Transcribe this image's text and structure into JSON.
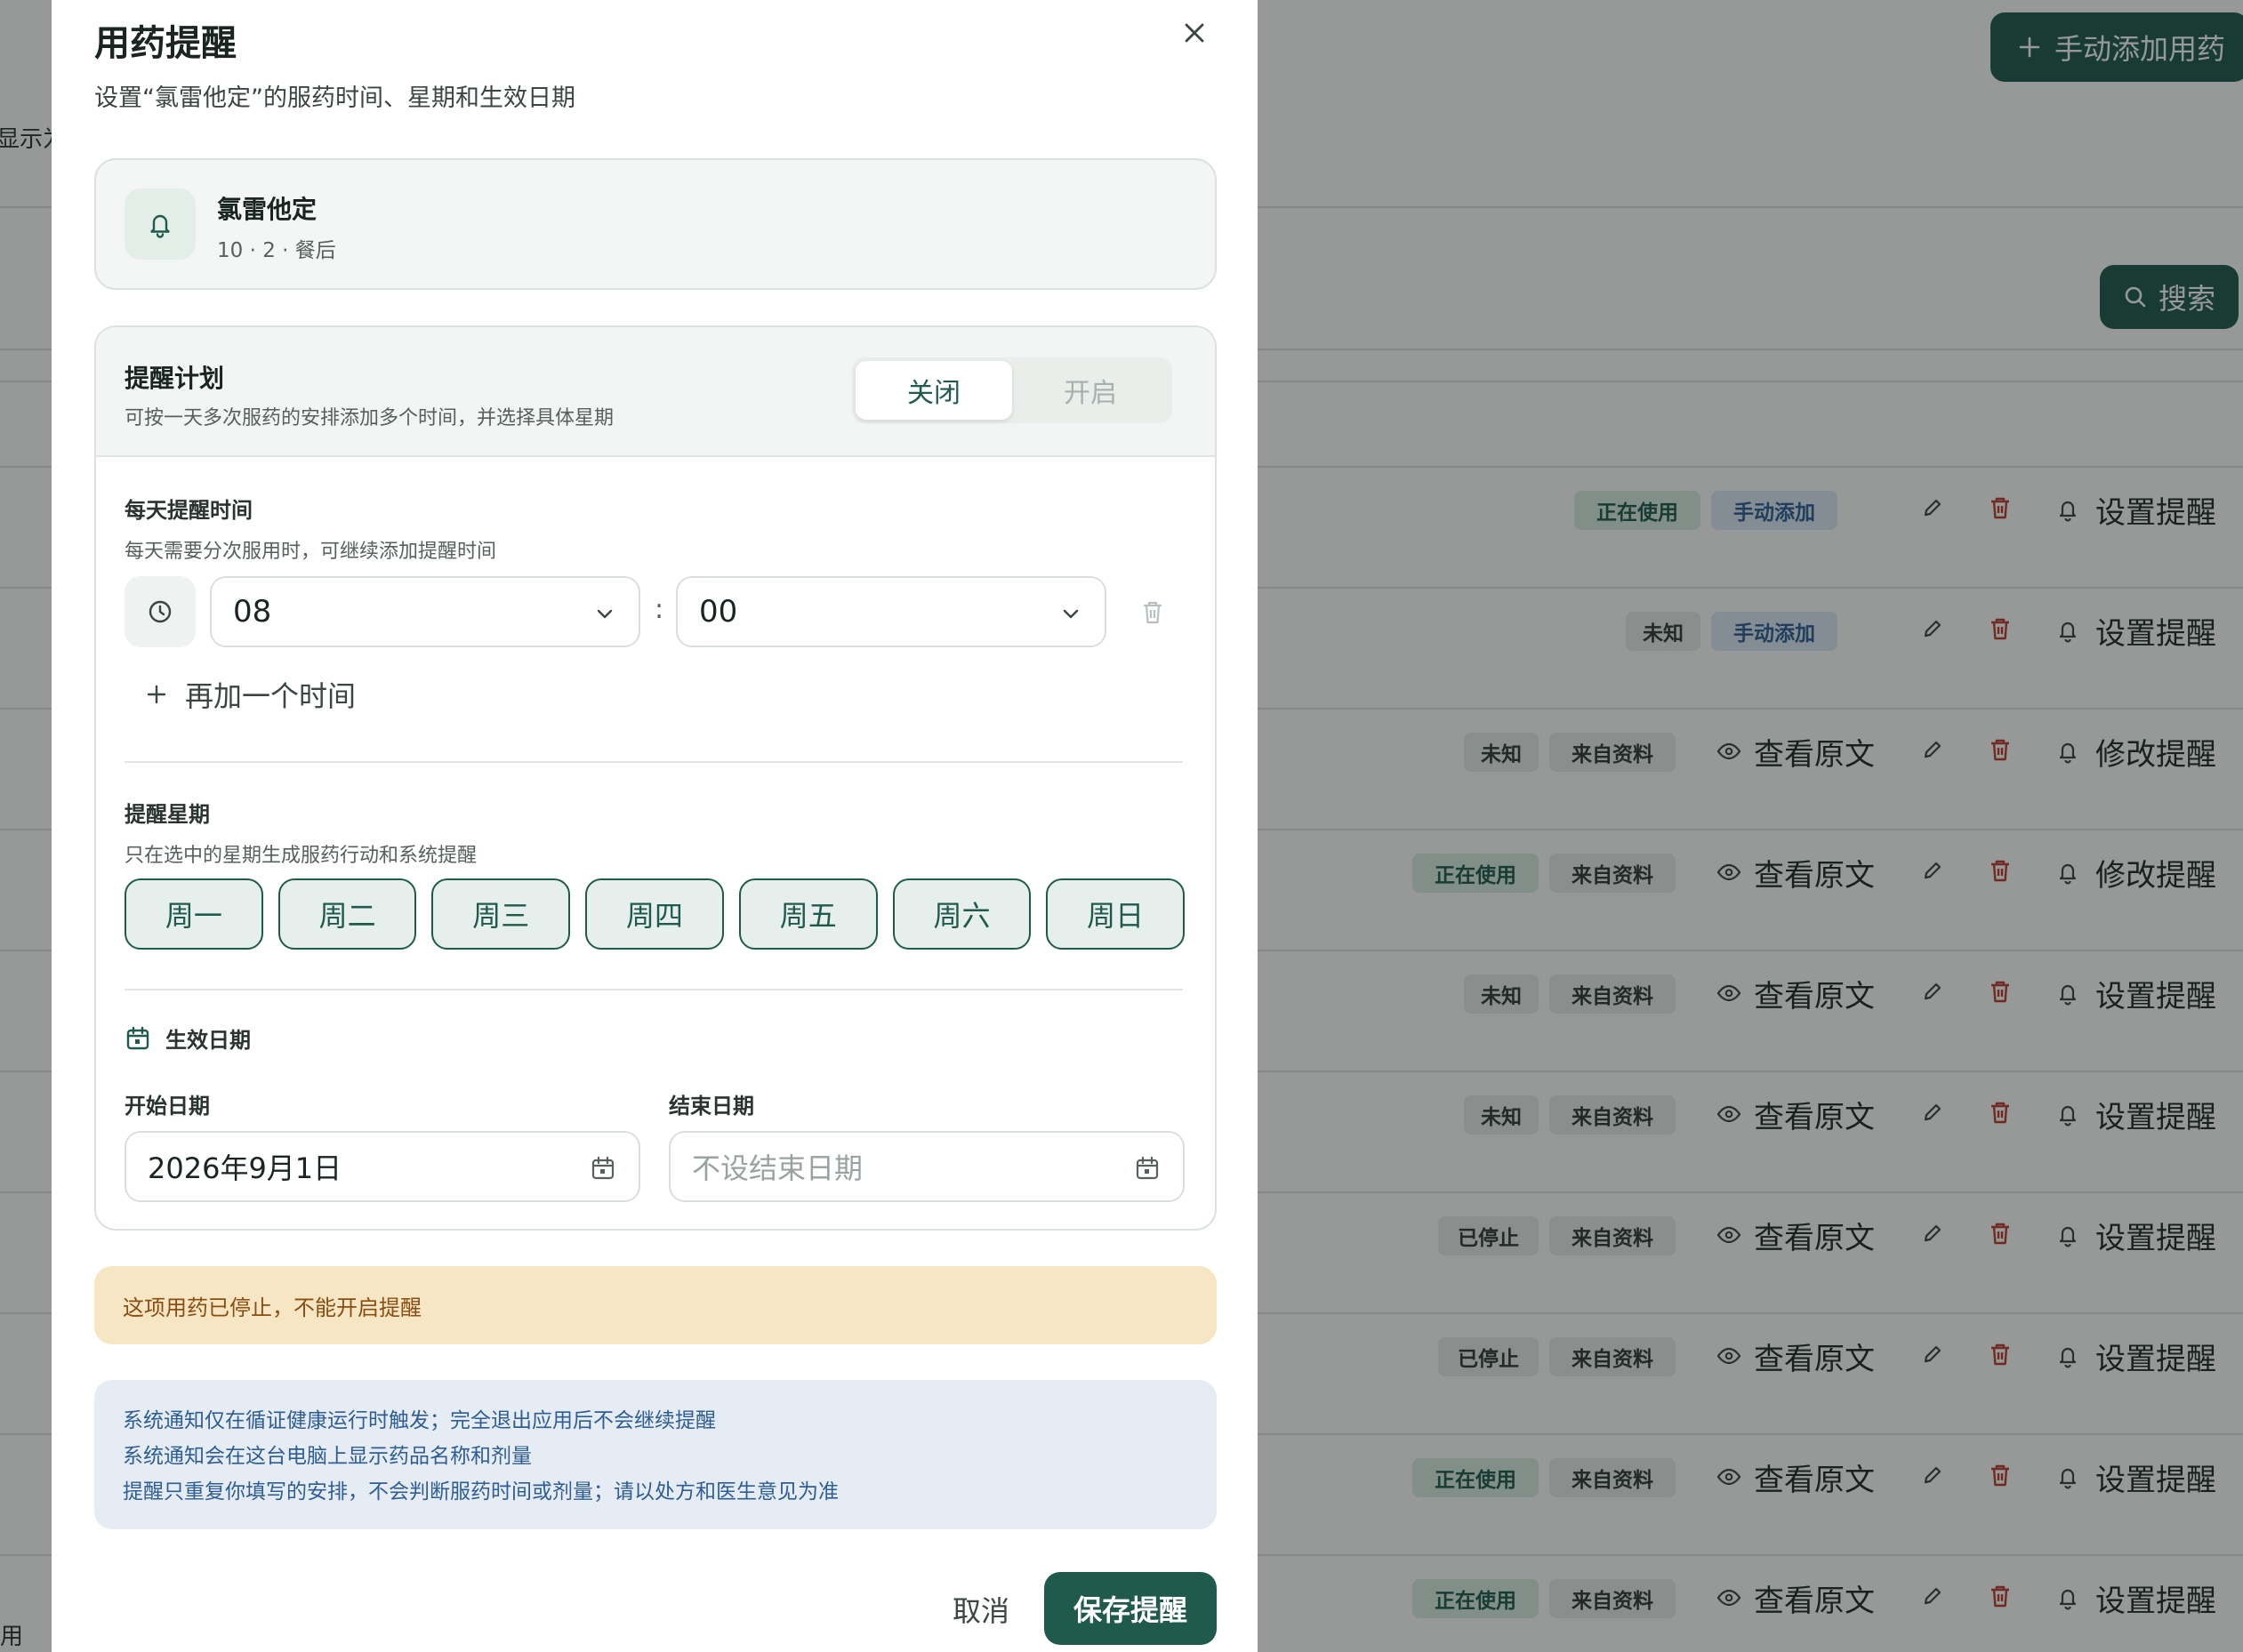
{
  "background": {
    "add_med_button": "手动添加用药",
    "search_button": "搜索",
    "left_text_top": "显示为",
    "left_text_bottom": "用",
    "rows": [
      {
        "status": "正在使用",
        "status_color": "green",
        "source": "手动添加",
        "source_color": "blue",
        "view": "",
        "remind": "设置提醒"
      },
      {
        "status": "未知",
        "status_color": "grey",
        "source": "手动添加",
        "source_color": "blue",
        "view": "",
        "remind": "设置提醒"
      },
      {
        "status": "未知",
        "status_color": "grey",
        "source": "来自资料",
        "source_color": "grey",
        "view": "查看原文",
        "remind": "修改提醒"
      },
      {
        "status": "正在使用",
        "status_color": "green",
        "source": "来自资料",
        "source_color": "grey",
        "view": "查看原文",
        "remind": "修改提醒"
      },
      {
        "status": "未知",
        "status_color": "grey",
        "source": "来自资料",
        "source_color": "grey",
        "view": "查看原文",
        "remind": "设置提醒"
      },
      {
        "status": "未知",
        "status_color": "grey",
        "source": "来自资料",
        "source_color": "grey",
        "view": "查看原文",
        "remind": "设置提醒"
      },
      {
        "status": "已停止",
        "status_color": "grey",
        "source": "来自资料",
        "source_color": "grey",
        "view": "查看原文",
        "remind": "设置提醒"
      },
      {
        "status": "已停止",
        "status_color": "grey",
        "source": "来自资料",
        "source_color": "grey",
        "view": "查看原文",
        "remind": "设置提醒"
      },
      {
        "status": "正在使用",
        "status_color": "green",
        "source": "来自资料",
        "source_color": "grey",
        "view": "查看原文",
        "remind": "设置提醒"
      },
      {
        "status": "正在使用",
        "status_color": "green",
        "source": "来自资料",
        "source_color": "grey",
        "view": "查看原文",
        "remind": "设置提醒"
      }
    ]
  },
  "dialog": {
    "title": "用药提醒",
    "subtitle": "设置“氯雷他定”的服药时间、星期和生效日期",
    "close_icon": "close-icon",
    "medication": {
      "name": "氯雷他定",
      "meta": "10 · 2 · 餐后",
      "icon": "bell-icon"
    },
    "plan": {
      "title": "提醒计划",
      "description": "可按一天多次服药的安排添加多个时间，并选择具体星期",
      "toggle_off": "关闭",
      "toggle_on": "开启",
      "selected": "关闭"
    },
    "daily_time": {
      "label": "每天提醒时间",
      "description": "每天需要分次服用时，可继续添加提醒时间",
      "hour": "08",
      "minute": "00",
      "separator": ":",
      "add_time": "再加一个时间"
    },
    "weekdays": {
      "label": "提醒星期",
      "description": "只在选中的星期生成服药行动和系统提醒",
      "days": [
        "周一",
        "周二",
        "周三",
        "周四",
        "周五",
        "周六",
        "周日"
      ]
    },
    "effective": {
      "label": "生效日期",
      "start_label": "开始日期",
      "start_value": "2026年9月1日",
      "end_label": "结束日期",
      "end_placeholder": "不设结束日期"
    },
    "warning": "这项用药已停止，不能开启提醒",
    "info_lines": [
      "系统通知仅在循证健康运行时触发；完全退出应用后不会继续提醒",
      "系统通知会在这台电脑上显示药品名称和剂量",
      "提醒只重复你填写的安排，不会判断服药时间或剂量；请以处方和医生意见为准"
    ],
    "cancel": "取消",
    "save": "保存提醒"
  },
  "colors": {
    "accent": "#1f5a4c",
    "warning_bg": "#f6e6c4",
    "warning_text": "#8a4d12",
    "info_bg": "#e5ecf3",
    "info_text": "#2f5d96",
    "danger": "#c0392b"
  }
}
